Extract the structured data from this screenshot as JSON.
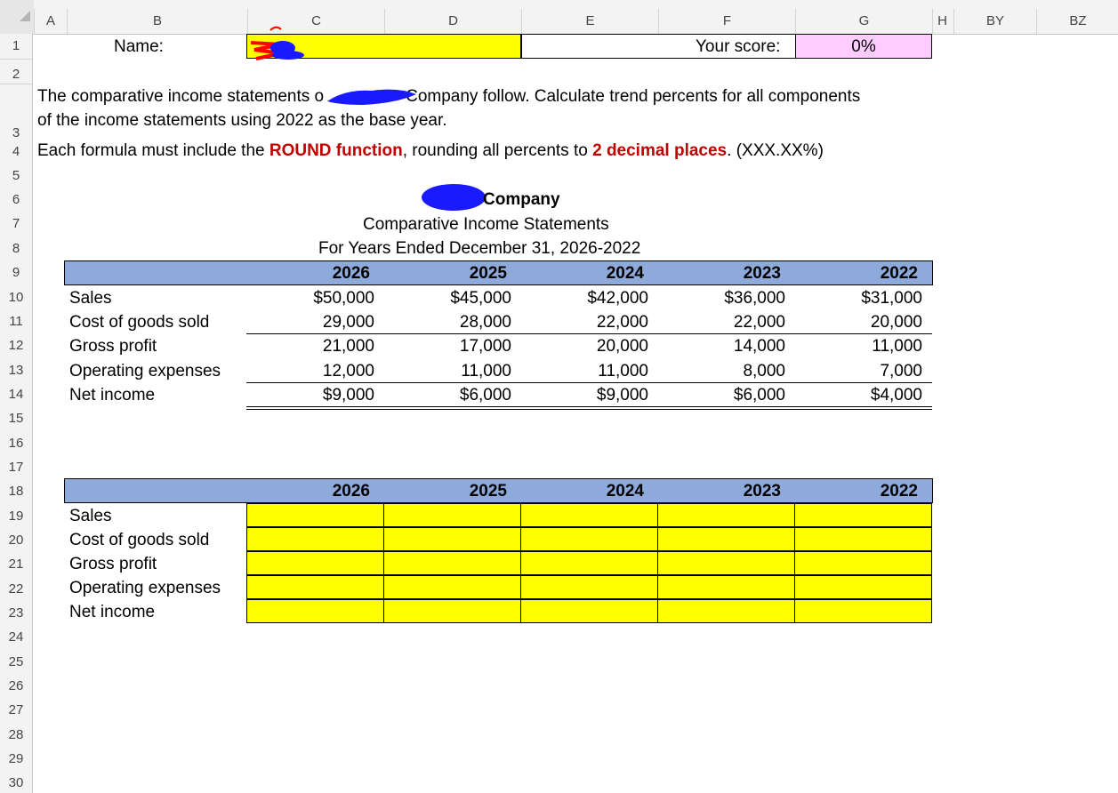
{
  "columns": [
    "A",
    "B",
    "C",
    "D",
    "E",
    "F",
    "G",
    "H",
    "BY",
    "BZ"
  ],
  "rows": [
    "1",
    "2",
    "3",
    "4",
    "5",
    "6",
    "7",
    "8",
    "9",
    "10",
    "11",
    "12",
    "13",
    "14",
    "15",
    "16",
    "17",
    "18",
    "19",
    "20",
    "21",
    "22",
    "23",
    "24",
    "25",
    "26",
    "27",
    "28",
    "29",
    "30"
  ],
  "header_row": {
    "name_label": "Name:",
    "score_label": "Your score:",
    "score_value": "0%"
  },
  "instructions": {
    "line1_part1": "The comparative income statements o",
    "line1_part2": "Company follow.  Calculate trend percents for all components",
    "line2": "of the income statements using 2022 as the base year.",
    "line3_a": "Each formula must include the ",
    "line3_b": "ROUND function",
    "line3_c": ", rounding all percents to ",
    "line3_d": "2 decimal places",
    "line3_e": ". (XXX.XX%)"
  },
  "statement": {
    "company": "Company",
    "title": "Comparative Income Statements",
    "period": "For Years Ended December 31, 2026-2022",
    "years": [
      "2026",
      "2025",
      "2024",
      "2023",
      "2022"
    ],
    "row_labels": [
      "Sales",
      "Cost of goods sold",
      "Gross profit",
      "Operating expenses",
      "Net income"
    ],
    "values": [
      [
        "$50,000",
        "$45,000",
        "$42,000",
        "$36,000",
        "$31,000"
      ],
      [
        "29,000",
        "28,000",
        "22,000",
        "22,000",
        "20,000"
      ],
      [
        "21,000",
        "17,000",
        "20,000",
        "14,000",
        "11,000"
      ],
      [
        "12,000",
        "11,000",
        "11,000",
        "8,000",
        "7,000"
      ],
      [
        "$9,000",
        "$6,000",
        "$9,000",
        "$6,000",
        "$4,000"
      ]
    ]
  },
  "trend_table": {
    "years": [
      "2026",
      "2025",
      "2024",
      "2023",
      "2022"
    ],
    "row_labels": [
      "Sales",
      "Cost of goods sold",
      "Gross profit",
      "Operating expenses",
      "Net income"
    ]
  },
  "colors": {
    "header_blue": "#8eaadb",
    "input_yellow": "#ffff00",
    "score_pink": "#ffccff",
    "emphasis_red": "#c00000",
    "redaction_blue": "#0000ff",
    "redaction_red": "#ff0000"
  }
}
